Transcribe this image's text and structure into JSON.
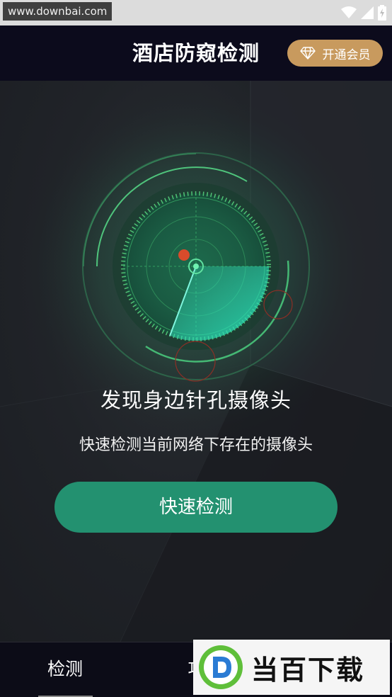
{
  "status_bar": {
    "watermark_url": "www.downbai.com",
    "icons": [
      "wifi-icon",
      "signal-icon",
      "battery-charging-icon"
    ]
  },
  "header": {
    "title": "酒店防窥检测",
    "vip_button_label": "开通会员",
    "vip_icon": "diamond-icon"
  },
  "main": {
    "headline": "发现身边针孔摄像头",
    "subtitle": "快速检测当前网络下存在的摄像头",
    "button_label": "快速检测"
  },
  "tabs": [
    {
      "label": "检测",
      "active": true
    },
    {
      "label": "攻",
      "active": false
    }
  ],
  "site_logo": {
    "text": "当百下载",
    "icon": "d-logo-icon"
  },
  "colors": {
    "header_bg": "#0c0b1c",
    "vip_gold": "#c89a5e",
    "primary_green": "#239170",
    "radar_green": "#4fe08a",
    "radar_teal": "#2ee0b8",
    "alert_red": "#d94b2b"
  }
}
